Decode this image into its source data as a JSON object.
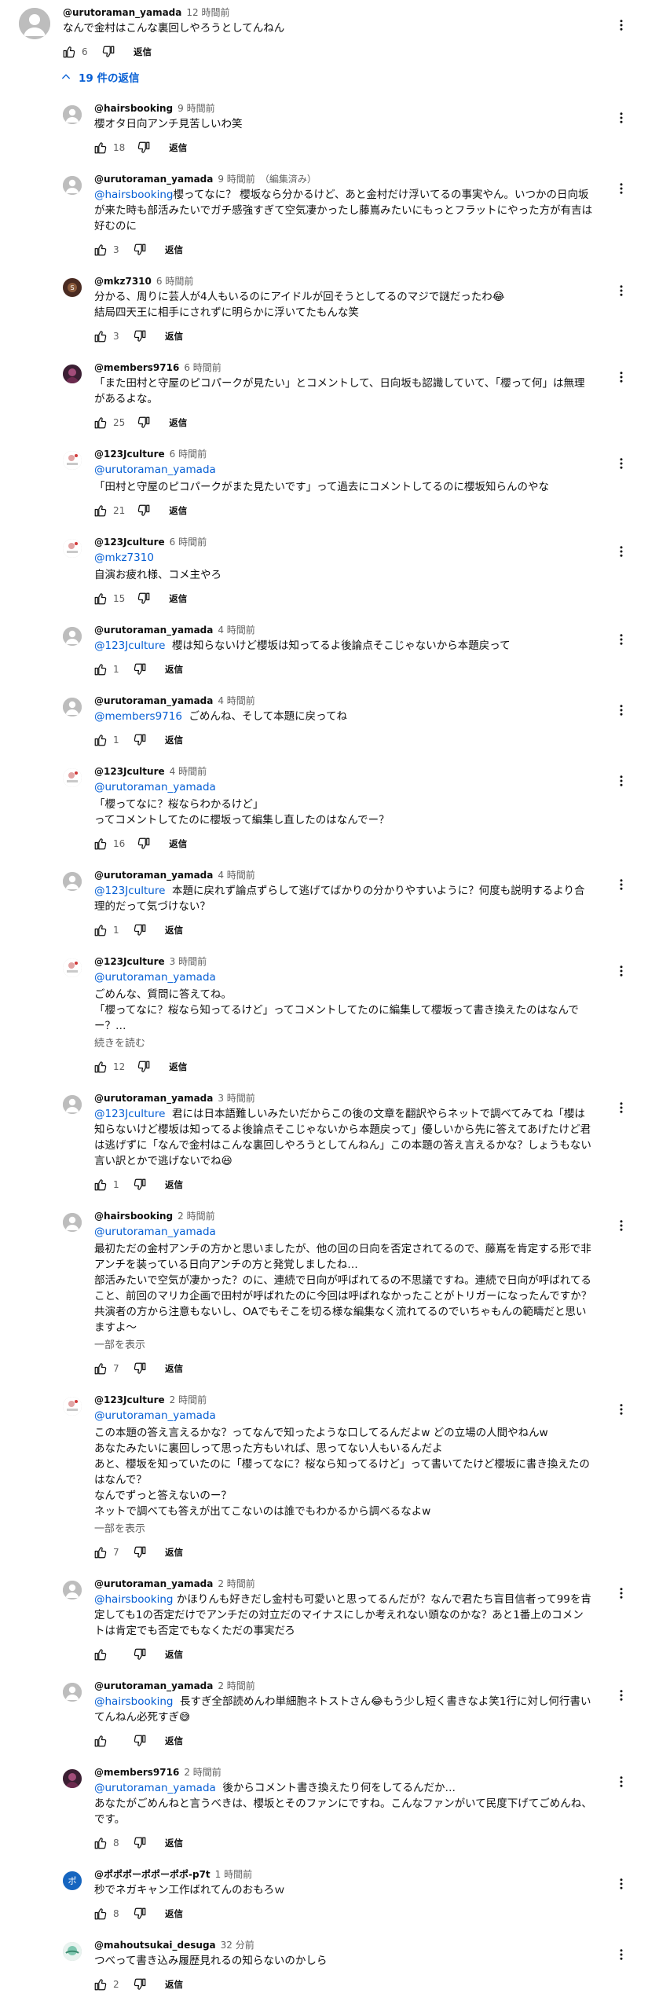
{
  "labels": {
    "reply": "返信",
    "show_more": "一部を表示",
    "read_more": "続きを読む"
  },
  "top_comment": {
    "author": "@urutoraman_yamada",
    "time": "12 時間前",
    "text": "なんで金村はこんな裏回しやろうとしてんねん",
    "likes": "6",
    "replies_toggle": "19 件の返信"
  },
  "replies": [
    {
      "author": "@hairsbooking",
      "time": "9 時間前",
      "avatar": "blank",
      "text": "櫻オタ日向アンチ見苦しいわ笑",
      "likes": "18"
    },
    {
      "author": "@urutoraman_yamada",
      "time": "9 時間前",
      "edited": "（編集済み）",
      "avatar": "blank",
      "mention": "@hairsbooking",
      "text": " 櫻坂なら分かるけど、あと金村だけ浮いてるの事実やん。いつかの日向坂が来た時も部活みたいでガチ感強すぎて空気凄かったし藤嶌みたいにもっとフラットにやった方が有吉は好むのに",
      "text_pre": "櫻ってなに？",
      "likes": "3"
    },
    {
      "author": "@mkz7310",
      "time": "6 時間前",
      "avatar": "mkz",
      "text": "分かる、周りに芸人が4人もいるのにアイドルが回そうとしてるのマジで謎だったわ😂\n結局四天王に相手にされずに明らかに浮いてたもんな笑",
      "likes": "3"
    },
    {
      "author": "@members9716",
      "time": "6 時間前",
      "avatar": "members",
      "text": "「また田村と守屋のピコパークが見たい」とコメントして、日向坂も認識していて、「櫻って何」は無理があるよな。",
      "likes": "25"
    },
    {
      "author": "@123Jculture",
      "time": "6 時間前",
      "avatar": "jculture",
      "mention_line": "@urutoraman_yamada",
      "text": "「田村と守屋のピコパークがまた見たいです」って過去にコメントしてるのに櫻坂知らんのやな",
      "likes": "21"
    },
    {
      "author": "@123Jculture",
      "time": "6 時間前",
      "avatar": "jculture",
      "mention_line": "@mkz7310",
      "text": "自演お疲れ様、コメ主やろ",
      "likes": "15"
    },
    {
      "author": "@urutoraman_yamada",
      "time": "4 時間前",
      "avatar": "blank",
      "mention": "@123Jculture",
      "text": "  櫻は知らないけど櫻坂は知ってるよ後論点そこじゃないから本題戻って",
      "likes": "1"
    },
    {
      "author": "@urutoraman_yamada",
      "time": "4 時間前",
      "avatar": "blank",
      "mention": "@members9716",
      "text": "  ごめんね、そして本題に戻ってね",
      "likes": "1"
    },
    {
      "author": "@123Jculture",
      "time": "4 時間前",
      "avatar": "jculture",
      "mention_line": "@urutoraman_yamada",
      "text": "「櫻ってなに？桜ならわかるけど」\nってコメントしてたのに櫻坂って編集し直したのはなんでー？",
      "likes": "16"
    },
    {
      "author": "@urutoraman_yamada",
      "time": "4 時間前",
      "avatar": "blank",
      "mention": "@123Jculture",
      "text": "  本題に戻れず論点ずらして逃げてばかりの分かりやすいように？何度も説明するより合理的だって気づけない？",
      "likes": "1"
    },
    {
      "author": "@123Jculture",
      "time": "3 時間前",
      "avatar": "jculture",
      "mention_line": "@urutoraman_yamada",
      "text": "ごめんな、質問に答えてね。\n「櫻ってなに？桜なら知ってるけど」ってコメントしてたのに編集して櫻坂って書き換えたのはなんでー？…",
      "more": "read_more",
      "likes": "12"
    },
    {
      "author": "@urutoraman_yamada",
      "time": "3 時間前",
      "avatar": "blank",
      "mention": "@123Jculture",
      "text": "  君には日本語難しいみたいだからこの後の文章を翻訳やらネットで調べてみてね「櫻は知らないけど櫻坂は知ってるよ後論点そこじゃないから本題戻って」優しいから先に答えてあげたけど君は逃げずに「なんで金村はこんな裏回しやろうとしてんねん」この本題の答え言えるかな？しょうもない言い訳とかで逃げないでね😆",
      "likes": "1"
    },
    {
      "author": "@hairsbooking",
      "time": "2 時間前",
      "avatar": "blank",
      "mention_line": "@urutoraman_yamada",
      "text": "最初ただの金村アンチの方かと思いましたが、他の回の日向を否定されてるので、藤嶌を肯定する形で非アンチを装っている日向アンチの方と発覚しましたね…\n部活みたいで空気が凄かった？のに、連続で日向が呼ばれてるの不思議ですね。連続で日向が呼ばれてること、前回のマリカ企画で田村が呼ばれたのに今回は呼ばれなかったことがトリガーになったんですか？\n共演者の方から注意もないし、OAでもそこを切る様な編集なく流れてるのでいちゃもんの範疇だと思いますよ〜",
      "more": "show_more",
      "likes": "7"
    },
    {
      "author": "@123Jculture",
      "time": "2 時間前",
      "avatar": "jculture",
      "mention_line": "@urutoraman_yamada",
      "text": "この本題の答え言えるかな？ってなんで知ったような口してるんだよw どの立場の人間やねんw\nあなたみたいに裏回しって思った方もいれば、思ってない人もいるんだよ\nあと、櫻坂を知っていたのに「櫻ってなに？桜なら知ってるけど」って書いてたけど櫻坂に書き換えたのはなんで？\nなんでずっと答えないのー？\nネットで調べても答えが出てこないのは誰でもわかるから調べるなよw",
      "more": "show_more",
      "likes": "7"
    },
    {
      "author": "@urutoraman_yamada",
      "time": "2 時間前",
      "avatar": "blank",
      "mention": "@hairsbooking",
      "text": " かほりんも好きだし金村も可愛いと思ってるんだが？なんで君たち盲目信者って99を肯定しても1の否定だけでアンチだの対立だのマイナスにしか考えれない頭なのかな？あと1番上のコメントは肯定でも否定でもなくただの事実だろ",
      "likes": ""
    },
    {
      "author": "@urutoraman_yamada",
      "time": "2 時間前",
      "avatar": "blank",
      "mention": "@hairsbooking",
      "text": "  長すぎ全部読めんわ単細胞ネトストさん😂もう少し短く書きなよ笑1行に対し何行書いてんねん必死すぎ😅",
      "likes": ""
    },
    {
      "author": "@members9716",
      "time": "2 時間前",
      "avatar": "members",
      "mention": "@urutoraman_yamada",
      "text": "  後からコメント書き換えたり何をしてるんだか…\nあなたがごめんねと言うべきは、櫻坂とそのファンにですね。こんなファンがいて民度下げてごめんね、です。",
      "likes": "8"
    },
    {
      "author": "@ポポポーポポーポポ-p7t",
      "time": "1 時間前",
      "avatar": "popo",
      "text": "秒でネガキャン工作ばれてんのおもろｗ",
      "likes": "8"
    },
    {
      "author": "@mahoutsukai_desugа",
      "time": "32 分前",
      "avatar": "mahou",
      "text": "つべって書き込み履歴見れるの知らないのかしら",
      "likes": "2"
    }
  ],
  "colors": {
    "link": "#065fd4",
    "muted": "#606060",
    "avatar_blank": "#bdbdbd",
    "text": "#0f0f0f"
  },
  "icons": [
    "like-icon",
    "dislike-icon",
    "more-vert-icon",
    "chevron-up-icon"
  ]
}
